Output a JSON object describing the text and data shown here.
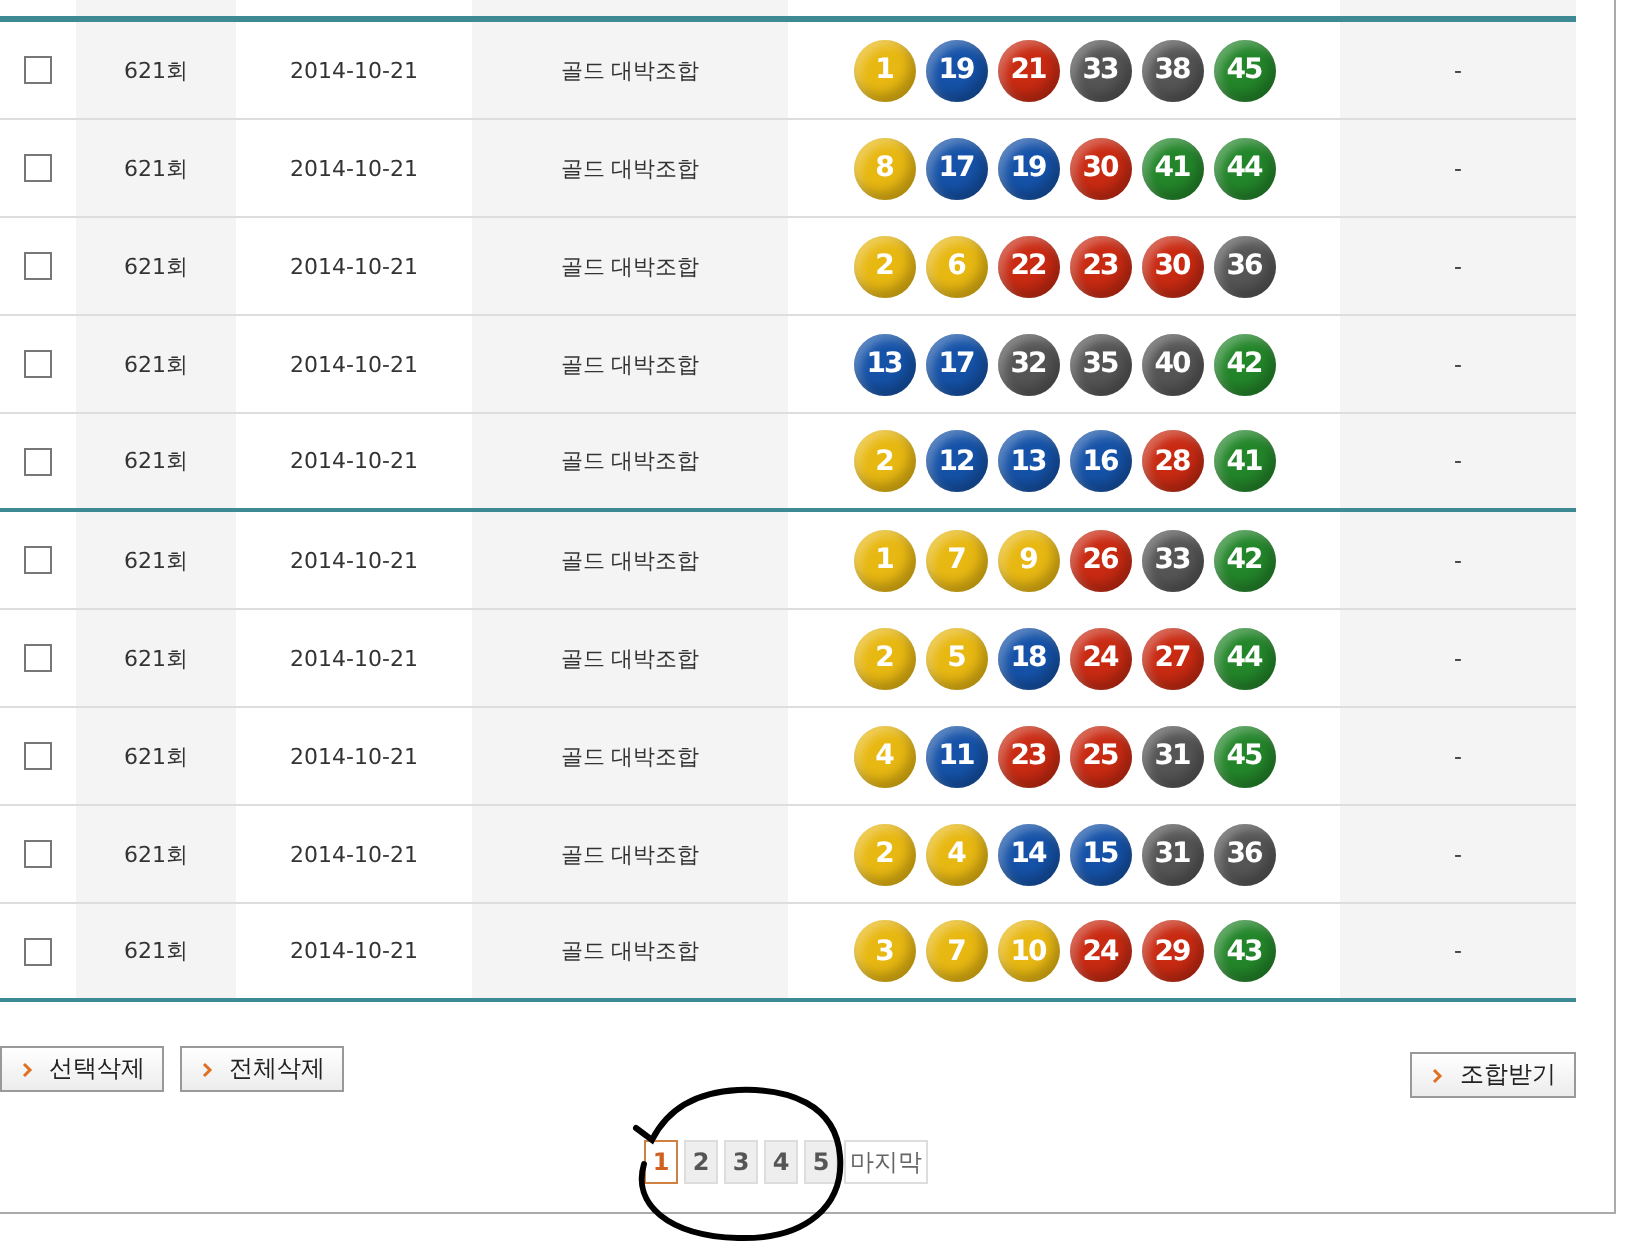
{
  "rows": [
    {
      "checked": false,
      "round": "621회",
      "date": "2014-10-21",
      "name": "골드 대박조합",
      "balls": [
        {
          "number": "1",
          "color": "#e8b812"
        },
        {
          "number": "19",
          "color": "#1552a8"
        },
        {
          "number": "21",
          "color": "#c92a12"
        },
        {
          "number": "33",
          "color": "#555555"
        },
        {
          "number": "38",
          "color": "#555555"
        },
        {
          "number": "45",
          "color": "#23862a"
        }
      ],
      "result": "-",
      "group_break": false
    },
    {
      "checked": false,
      "round": "621회",
      "date": "2014-10-21",
      "name": "골드 대박조합",
      "balls": [
        {
          "number": "8",
          "color": "#e8b812"
        },
        {
          "number": "17",
          "color": "#1552a8"
        },
        {
          "number": "19",
          "color": "#1552a8"
        },
        {
          "number": "30",
          "color": "#c92a12"
        },
        {
          "number": "41",
          "color": "#23862a"
        },
        {
          "number": "44",
          "color": "#23862a"
        }
      ],
      "result": "-",
      "group_break": false
    },
    {
      "checked": false,
      "round": "621회",
      "date": "2014-10-21",
      "name": "골드 대박조합",
      "balls": [
        {
          "number": "2",
          "color": "#e8b812"
        },
        {
          "number": "6",
          "color": "#e8b812"
        },
        {
          "number": "22",
          "color": "#c92a12"
        },
        {
          "number": "23",
          "color": "#c92a12"
        },
        {
          "number": "30",
          "color": "#c92a12"
        },
        {
          "number": "36",
          "color": "#555555"
        }
      ],
      "result": "-",
      "group_break": false
    },
    {
      "checked": false,
      "round": "621회",
      "date": "2014-10-21",
      "name": "골드 대박조합",
      "balls": [
        {
          "number": "13",
          "color": "#1552a8"
        },
        {
          "number": "17",
          "color": "#1552a8"
        },
        {
          "number": "32",
          "color": "#555555"
        },
        {
          "number": "35",
          "color": "#555555"
        },
        {
          "number": "40",
          "color": "#555555"
        },
        {
          "number": "42",
          "color": "#23862a"
        }
      ],
      "result": "-",
      "group_break": false
    },
    {
      "checked": false,
      "round": "621회",
      "date": "2014-10-21",
      "name": "골드 대박조합",
      "balls": [
        {
          "number": "2",
          "color": "#e8b812"
        },
        {
          "number": "12",
          "color": "#1552a8"
        },
        {
          "number": "13",
          "color": "#1552a8"
        },
        {
          "number": "16",
          "color": "#1552a8"
        },
        {
          "number": "28",
          "color": "#c92a12"
        },
        {
          "number": "41",
          "color": "#23862a"
        }
      ],
      "result": "-",
      "group_break": true
    },
    {
      "checked": false,
      "round": "621회",
      "date": "2014-10-21",
      "name": "골드 대박조합",
      "balls": [
        {
          "number": "1",
          "color": "#e8b812"
        },
        {
          "number": "7",
          "color": "#e8b812"
        },
        {
          "number": "9",
          "color": "#e8b812"
        },
        {
          "number": "26",
          "color": "#c92a12"
        },
        {
          "number": "33",
          "color": "#555555"
        },
        {
          "number": "42",
          "color": "#23862a"
        }
      ],
      "result": "-",
      "group_break": false
    },
    {
      "checked": false,
      "round": "621회",
      "date": "2014-10-21",
      "name": "골드 대박조합",
      "balls": [
        {
          "number": "2",
          "color": "#e8b812"
        },
        {
          "number": "5",
          "color": "#e8b812"
        },
        {
          "number": "18",
          "color": "#1552a8"
        },
        {
          "number": "24",
          "color": "#c92a12"
        },
        {
          "number": "27",
          "color": "#c92a12"
        },
        {
          "number": "44",
          "color": "#23862a"
        }
      ],
      "result": "-",
      "group_break": false
    },
    {
      "checked": false,
      "round": "621회",
      "date": "2014-10-21",
      "name": "골드 대박조합",
      "balls": [
        {
          "number": "4",
          "color": "#e8b812"
        },
        {
          "number": "11",
          "color": "#1552a8"
        },
        {
          "number": "23",
          "color": "#c92a12"
        },
        {
          "number": "25",
          "color": "#c92a12"
        },
        {
          "number": "31",
          "color": "#555555"
        },
        {
          "number": "45",
          "color": "#23862a"
        }
      ],
      "result": "-",
      "group_break": false
    },
    {
      "checked": false,
      "round": "621회",
      "date": "2014-10-21",
      "name": "골드 대박조합",
      "balls": [
        {
          "number": "2",
          "color": "#e8b812"
        },
        {
          "number": "4",
          "color": "#e8b812"
        },
        {
          "number": "14",
          "color": "#1552a8"
        },
        {
          "number": "15",
          "color": "#1552a8"
        },
        {
          "number": "31",
          "color": "#555555"
        },
        {
          "number": "36",
          "color": "#555555"
        }
      ],
      "result": "-",
      "group_break": false
    },
    {
      "checked": false,
      "round": "621회",
      "date": "2014-10-21",
      "name": "골드 대박조합",
      "balls": [
        {
          "number": "3",
          "color": "#e8b812"
        },
        {
          "number": "7",
          "color": "#e8b812"
        },
        {
          "number": "10",
          "color": "#e8b812"
        },
        {
          "number": "24",
          "color": "#c92a12"
        },
        {
          "number": "29",
          "color": "#c92a12"
        },
        {
          "number": "43",
          "color": "#23862a"
        }
      ],
      "result": "-",
      "group_break": true
    }
  ],
  "left_buttons": [
    "선택삭제",
    "전체삭제"
  ],
  "right_button": "조합받기",
  "pagination": {
    "pages": [
      {
        "label": "1",
        "selected": true
      },
      {
        "label": "2",
        "selected": false
      },
      {
        "label": "3",
        "selected": false
      },
      {
        "label": "4",
        "selected": false
      },
      {
        "label": "5",
        "selected": false
      }
    ],
    "last": "마지막"
  },
  "annotation": {
    "kind": "circle"
  }
}
